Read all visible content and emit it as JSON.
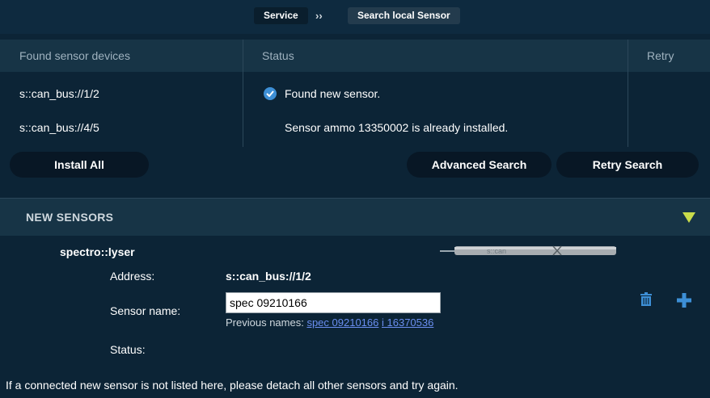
{
  "breadcrumb": {
    "service": "Service",
    "separator": "››",
    "current": "Search local Sensor"
  },
  "table": {
    "headers": [
      "Found sensor devices",
      "Status",
      "Retry"
    ],
    "rows": [
      {
        "device": "s::can_bus://1/2",
        "status": "Found new sensor.",
        "status_icon": "check-circle-icon"
      },
      {
        "device": "s::can_bus://4/5",
        "status": "Sensor ammo 13350002 is already installed."
      }
    ]
  },
  "buttons": {
    "install_all": "Install All",
    "advanced_search": "Advanced Search",
    "retry_search": "Retry Search"
  },
  "new_sensors": {
    "title": "NEW SENSORS",
    "toggle_icon": "triangle-down-icon",
    "sensor": {
      "name": "spectro::lyser",
      "address_label": "Address:",
      "address_value": "s::can_bus://1/2",
      "name_label": "Sensor name:",
      "name_value": "spec 09210166",
      "previous_label": "Previous names:",
      "previous_names": [
        "spec 09210166",
        "i 16370536"
      ],
      "status_label": "Status:",
      "image_label": "s::can"
    }
  },
  "footer": "If a connected new sensor is not listed here, please detach all other sensors and try again.",
  "colors": {
    "background": "#0c2436",
    "header": "#173446",
    "accent_blue": "#3d8fd6",
    "triangle": "#c9dc4b",
    "link": "#6a8ef0"
  }
}
